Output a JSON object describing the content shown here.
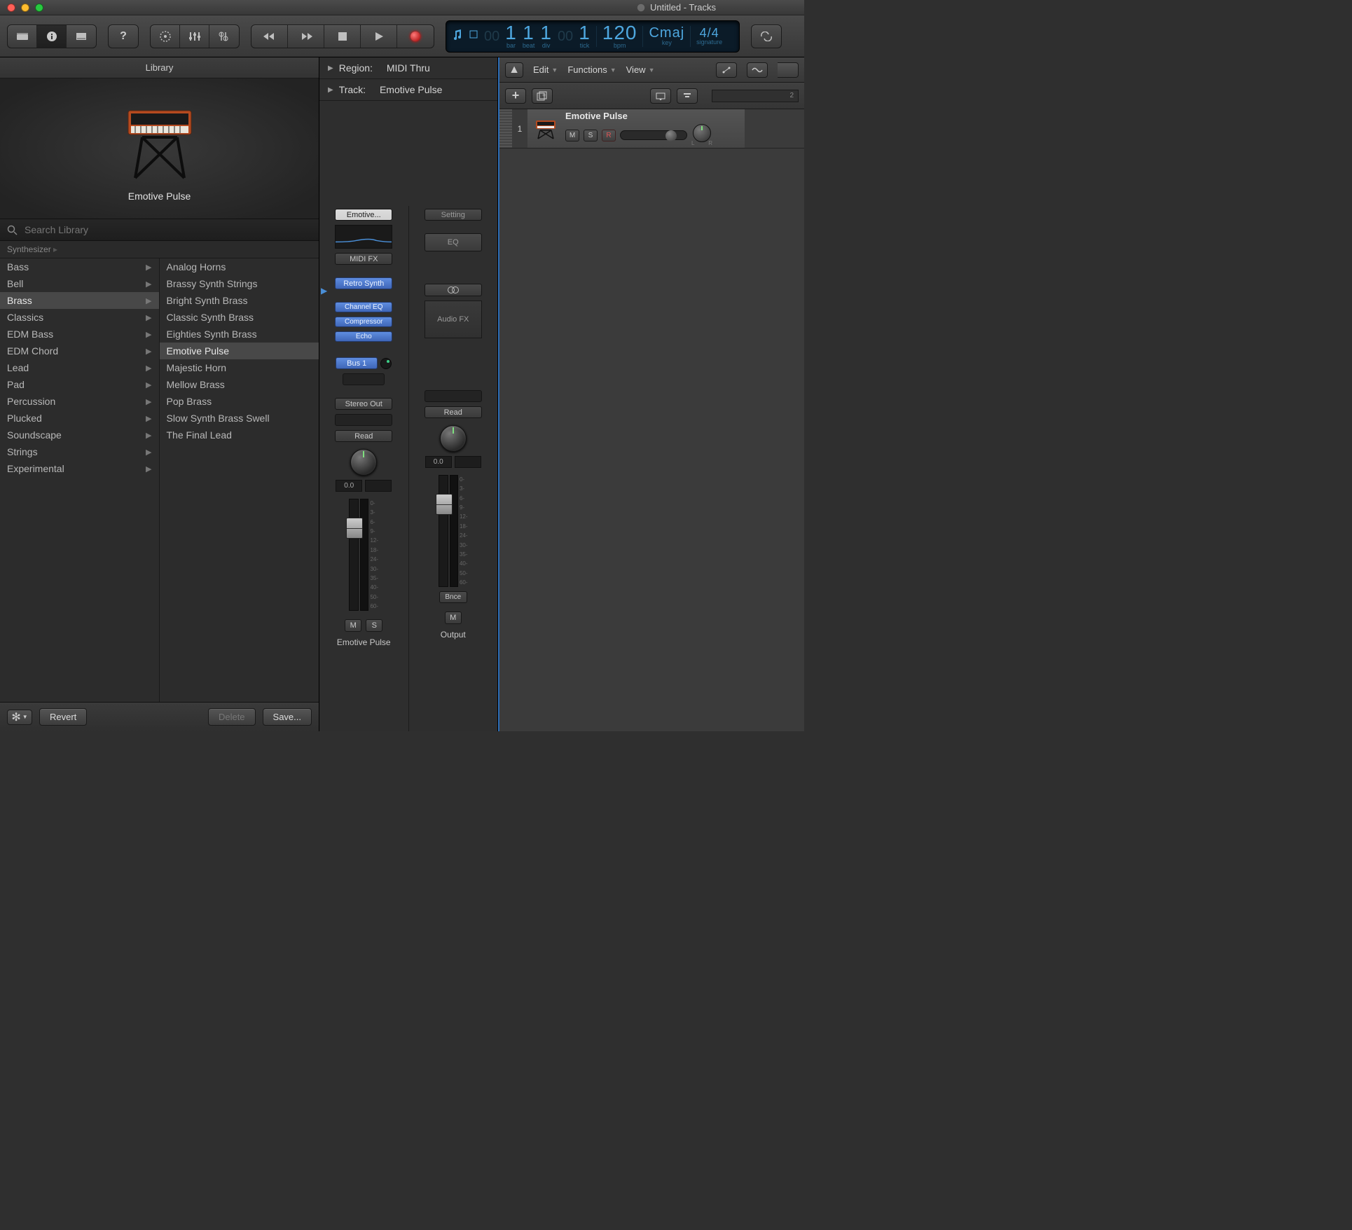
{
  "window": {
    "title": "Untitled - Tracks"
  },
  "lcd": {
    "bar": "1",
    "beat": "1",
    "div": "1",
    "tick": "1",
    "bpm": "120",
    "key": "Cmaj",
    "sig_num": "4",
    "sig_den": "4",
    "labels": {
      "bar": "bar",
      "beat": "beat",
      "div": "div",
      "tick": "tick",
      "bpm": "bpm",
      "key": "key",
      "signature": "signature"
    }
  },
  "library": {
    "title": "Library",
    "preview_name": "Emotive Pulse",
    "search_placeholder": "Search Library",
    "breadcrumb": "Synthesizer",
    "col1_selected": "Brass",
    "col2_selected": "Emotive Pulse",
    "col1": [
      "Bass",
      "Bell",
      "Brass",
      "Classics",
      "EDM Bass",
      "EDM Chord",
      "Lead",
      "Pad",
      "Percussion",
      "Plucked",
      "Soundscape",
      "Strings",
      "Experimental"
    ],
    "col2": [
      "Analog Horns",
      "Brassy Synth Strings",
      "Bright Synth Brass",
      "Classic Synth Brass",
      "Eighties Synth Brass",
      "Emotive Pulse",
      "Majestic Horn",
      "Mellow Brass",
      "Pop Brass",
      "Slow Synth Brass Swell",
      "The Final Lead"
    ],
    "footer": {
      "revert": "Revert",
      "delete": "Delete",
      "save": "Save..."
    }
  },
  "inspector": {
    "region_label": "Region:",
    "region_value": "MIDI Thru",
    "track_label": "Track:",
    "track_value": "Emotive Pulse",
    "strip1": {
      "preset": "Emotive...",
      "midi_fx": "MIDI FX",
      "instrument": "Retro Synth",
      "fx": [
        "Channel EQ",
        "Compressor",
        "Echo"
      ],
      "send": "Bus 1",
      "output": "Stereo Out",
      "automation": "Read",
      "db": "0.0",
      "scale": [
        "0-",
        "3-",
        "6-",
        "9-",
        "12-",
        "18-",
        "24-",
        "30-",
        "35-",
        "40-",
        "50-",
        "60-"
      ],
      "mute": "M",
      "solo": "S",
      "name": "Emotive Pulse"
    },
    "strip2": {
      "setting": "Setting",
      "eq": "EQ",
      "audio_fx": "Audio FX",
      "automation": "Read",
      "db": "0.0",
      "bnce": "Bnce",
      "mute": "M",
      "name": "Output"
    }
  },
  "tracks": {
    "menus": {
      "edit": "Edit",
      "functions": "Functions",
      "view": "View"
    },
    "ruler_start": "2",
    "track1": {
      "num": "1",
      "name": "Emotive Pulse",
      "mute": "M",
      "solo": "S",
      "rec": "R",
      "lr_l": "L",
      "lr_r": "R"
    }
  }
}
